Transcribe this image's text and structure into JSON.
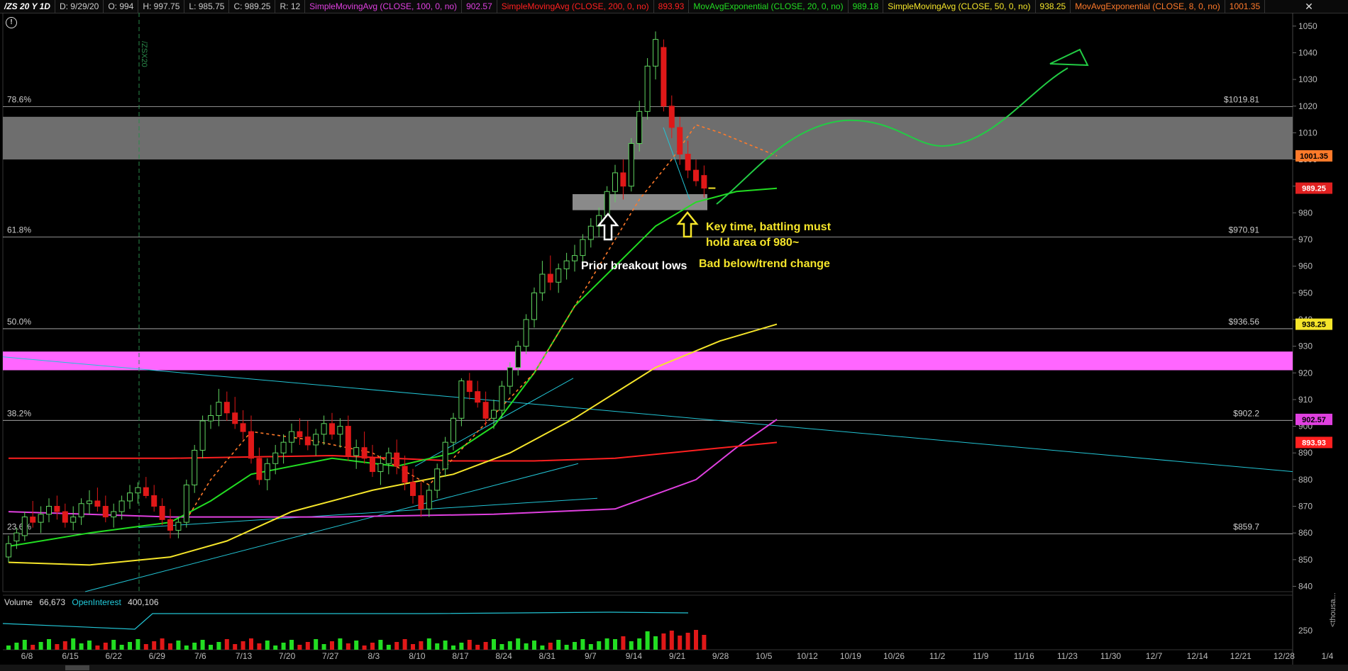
{
  "header": {
    "symbol": "/ZS 20 Y 1D",
    "date": "D: 9/29/20",
    "open": "O: 994",
    "high": "H: 997.75",
    "low": "L: 985.75",
    "close": "C: 989.25",
    "range": "R: 12",
    "studies": [
      {
        "label": "SimpleMovingAvg (CLOSE, 100, 0, no)",
        "value": "902.57",
        "color": "#e040e0"
      },
      {
        "label": "SimpleMovingAvg (CLOSE, 200, 0, no)",
        "value": "893.93",
        "color": "#ff2020"
      },
      {
        "label": "MovAvgExponential (CLOSE, 20, 0, no)",
        "value": "989.18",
        "color": "#22dd22"
      },
      {
        "label": "SimpleMovingAvg (CLOSE, 50, 0, no)",
        "value": "938.25",
        "color": "#f5e52a"
      },
      {
        "label": "MovAvgExponential (CLOSE, 8, 0, no)",
        "value": "1001.35",
        "color": "#ff7a2a"
      }
    ]
  },
  "chart_data": {
    "type": "candlestick",
    "ylim": [
      838,
      1055
    ],
    "y_ticks": [
      840,
      850,
      860,
      870,
      880,
      890,
      900,
      910,
      920,
      930,
      940,
      950,
      960,
      970,
      980,
      990,
      1000,
      1010,
      1020,
      1030,
      1040,
      1050
    ],
    "x_labels": [
      "6/8",
      "6/15",
      "6/22",
      "6/29",
      "7/6",
      "7/13",
      "7/20",
      "7/27",
      "8/3",
      "8/10",
      "8/17",
      "8/24",
      "8/31",
      "9/7",
      "9/14",
      "9/21",
      "9/28",
      "10/5",
      "10/12",
      "10/19",
      "10/26",
      "11/2",
      "11/9",
      "11/16",
      "11/23",
      "11/30",
      "12/7",
      "12/14",
      "12/21",
      "12/28",
      "1/4"
    ],
    "candles": [
      [
        851,
        859,
        849,
        856
      ],
      [
        857,
        862,
        854,
        860
      ],
      [
        859,
        868,
        857,
        866
      ],
      [
        866,
        872,
        862,
        864
      ],
      [
        864,
        870,
        860,
        867
      ],
      [
        867,
        873,
        864,
        870
      ],
      [
        870,
        874,
        865,
        868
      ],
      [
        868,
        871,
        862,
        864
      ],
      [
        864,
        870,
        861,
        866
      ],
      [
        866,
        873,
        863,
        871
      ],
      [
        871,
        876,
        867,
        872
      ],
      [
        872,
        877,
        868,
        870
      ],
      [
        870,
        874,
        864,
        866
      ],
      [
        866,
        871,
        862,
        868
      ],
      [
        868,
        874,
        865,
        872
      ],
      [
        872,
        878,
        869,
        875
      ],
      [
        875,
        879,
        871,
        877
      ],
      [
        877,
        881,
        873,
        874
      ],
      [
        874,
        878,
        868,
        870
      ],
      [
        870,
        873,
        863,
        865
      ],
      [
        865,
        869,
        858,
        861
      ],
      [
        861,
        866,
        858,
        864
      ],
      [
        864,
        880,
        862,
        878
      ],
      [
        878,
        893,
        875,
        891
      ],
      [
        891,
        904,
        888,
        902
      ],
      [
        902,
        908,
        899,
        904
      ],
      [
        904,
        914,
        900,
        909
      ],
      [
        909,
        913,
        902,
        905
      ],
      [
        905,
        911,
        899,
        901
      ],
      [
        901,
        906,
        895,
        898
      ],
      [
        898,
        904,
        886,
        888
      ],
      [
        888,
        892,
        878,
        880
      ],
      [
        880,
        888,
        876,
        886
      ],
      [
        886,
        893,
        882,
        890
      ],
      [
        890,
        897,
        886,
        894
      ],
      [
        894,
        901,
        890,
        898
      ],
      [
        898,
        903,
        893,
        896
      ],
      [
        896,
        902,
        891,
        893
      ],
      [
        893,
        899,
        889,
        897
      ],
      [
        897,
        904,
        893,
        901
      ],
      [
        901,
        905,
        895,
        897
      ],
      [
        897,
        903,
        892,
        900
      ],
      [
        900,
        904,
        887,
        889
      ],
      [
        889,
        895,
        884,
        892
      ],
      [
        892,
        898,
        886,
        888
      ],
      [
        888,
        893,
        881,
        883
      ],
      [
        883,
        889,
        878,
        886
      ],
      [
        886,
        892,
        882,
        890
      ],
      [
        890,
        895,
        882,
        885
      ],
      [
        885,
        889,
        876,
        879
      ],
      [
        879,
        884,
        871,
        874
      ],
      [
        874,
        879,
        866,
        869
      ],
      [
        869,
        878,
        866,
        876
      ],
      [
        876,
        886,
        873,
        884
      ],
      [
        884,
        896,
        881,
        894
      ],
      [
        894,
        905,
        891,
        903
      ],
      [
        903,
        918,
        900,
        917
      ],
      [
        917,
        920,
        910,
        913
      ],
      [
        913,
        917,
        907,
        909
      ],
      [
        909,
        913,
        900,
        903
      ],
      [
        903,
        910,
        899,
        906
      ],
      [
        906,
        917,
        903,
        915
      ],
      [
        915,
        924,
        912,
        922
      ],
      [
        922,
        932,
        919,
        930
      ],
      [
        930,
        942,
        927,
        940
      ],
      [
        940,
        952,
        937,
        950
      ],
      [
        950,
        962,
        947,
        957
      ],
      [
        957,
        964,
        951,
        954
      ],
      [
        954,
        961,
        950,
        959
      ],
      [
        959,
        965,
        955,
        962
      ],
      [
        962,
        968,
        958,
        964
      ],
      [
        964,
        972,
        961,
        970
      ],
      [
        970,
        978,
        967,
        975
      ],
      [
        975,
        982,
        971,
        979
      ],
      [
        979,
        990,
        977,
        988
      ],
      [
        988,
        998,
        984,
        995
      ],
      [
        995,
        1000,
        985,
        990
      ],
      [
        990,
        1008,
        988,
        1006
      ],
      [
        1006,
        1022,
        1003,
        1018
      ],
      [
        1018,
        1038,
        1015,
        1035
      ],
      [
        1035,
        1048,
        1030,
        1045
      ],
      [
        1042,
        1045,
        1018,
        1020
      ],
      [
        1020,
        1024,
        1008,
        1012
      ],
      [
        1012,
        1016,
        998,
        1002
      ],
      [
        1002,
        1007,
        993,
        996
      ],
      [
        996,
        1000,
        990,
        992
      ],
      [
        994,
        997.75,
        985.75,
        989.25
      ]
    ],
    "series": [
      {
        "name": "SimpleMovingAvg (CLOSE, 100, 0, no)",
        "color": "#e040e0",
        "points": [
          [
            0,
            868
          ],
          [
            20,
            866
          ],
          [
            40,
            866
          ],
          [
            60,
            867
          ],
          [
            75,
            869
          ],
          [
            85,
            880
          ],
          [
            90,
            892
          ],
          [
            95,
            902.57
          ]
        ]
      },
      {
        "name": "SimpleMovingAvg (CLOSE, 200, 0, no)",
        "color": "#ff2020",
        "points": [
          [
            0,
            888
          ],
          [
            20,
            888
          ],
          [
            40,
            889
          ],
          [
            55,
            887
          ],
          [
            65,
            887
          ],
          [
            75,
            888
          ],
          [
            85,
            891
          ],
          [
            95,
            893.93
          ]
        ]
      },
      {
        "name": "MovAvgExponential (CLOSE, 20, 0, no)",
        "color": "#22dd22",
        "points": [
          [
            0,
            855
          ],
          [
            10,
            860
          ],
          [
            20,
            864
          ],
          [
            25,
            872
          ],
          [
            30,
            882
          ],
          [
            40,
            888
          ],
          [
            48,
            885
          ],
          [
            55,
            890
          ],
          [
            60,
            900
          ],
          [
            65,
            920
          ],
          [
            70,
            945
          ],
          [
            75,
            960
          ],
          [
            80,
            975
          ],
          [
            85,
            984
          ],
          [
            90,
            988
          ],
          [
            95,
            989.18
          ]
        ]
      },
      {
        "name": "SimpleMovingAvg (CLOSE, 50, 0, no)",
        "color": "#f5e52a",
        "points": [
          [
            0,
            849
          ],
          [
            10,
            848
          ],
          [
            20,
            851
          ],
          [
            27,
            857
          ],
          [
            35,
            868
          ],
          [
            45,
            876
          ],
          [
            55,
            882
          ],
          [
            62,
            890
          ],
          [
            70,
            903
          ],
          [
            80,
            922
          ],
          [
            88,
            932
          ],
          [
            95,
            938.25
          ]
        ]
      },
      {
        "name": "MovAvgExponential (CLOSE, 8, 0, no)",
        "color": "#ff7a2a",
        "points": [
          [
            22,
            865
          ],
          [
            25,
            880
          ],
          [
            30,
            898
          ],
          [
            37,
            895
          ],
          [
            45,
            890
          ],
          [
            52,
            878
          ],
          [
            58,
            898
          ],
          [
            65,
            920
          ],
          [
            72,
            955
          ],
          [
            78,
            985
          ],
          [
            82,
            1000
          ],
          [
            85,
            1013
          ],
          [
            88,
            1010
          ],
          [
            95,
            1001.35
          ]
        ]
      }
    ],
    "fib_levels": [
      {
        "label": "78.6%",
        "price_label": "$1019.81",
        "value": 1019.81
      },
      {
        "label": "61.8%",
        "price_label": "$970.91",
        "value": 970.91
      },
      {
        "label": "50.0%",
        "price_label": "$936.56",
        "value": 936.56
      },
      {
        "label": "38.2%",
        "price_label": "$902.2",
        "value": 902.2
      },
      {
        "label": "23.6%",
        "price_label": "$859.7",
        "value": 859.7
      }
    ],
    "zones": [
      {
        "from": 1000,
        "to": 1016,
        "color": "#6e6e6e",
        "x0": 0,
        "x1": 1
      },
      {
        "from": 921,
        "to": 928,
        "color": "#ff66ff",
        "x0": 0,
        "x1": 1
      },
      {
        "from": 981,
        "to": 987,
        "color": "#8a8a8a",
        "x0": 0.44,
        "x1": 0.545
      }
    ],
    "right_price_tags": [
      {
        "value": 1001.35,
        "text": "1001.35",
        "bg": "#ff7a2a",
        "fg": "#000"
      },
      {
        "value": 989.25,
        "text": "989.25",
        "bg": "#e02020",
        "fg": "#fff"
      },
      {
        "value": 938.25,
        "text": "938.25",
        "bg": "#f5e52a",
        "fg": "#000"
      },
      {
        "value": 902.57,
        "text": "902.57",
        "bg": "#e040e0",
        "fg": "#000"
      },
      {
        "value": 893.93,
        "text": "893.93",
        "bg": "#ff2020",
        "fg": "#fff"
      }
    ],
    "vertical_marker_label": "/ZSX20",
    "volume": {
      "label": "Volume",
      "value": "66,673",
      "oi_label": "OpenInterest",
      "oi_value": "400,106",
      "tick": "250",
      "unit_label": "<thousa..."
    }
  },
  "annotations": {
    "prior_breakout": "Prior breakout lows",
    "key_time_1": "Key time, battling must",
    "key_time_2": "hold area of 980~",
    "bad_below": "Bad below/trend change"
  }
}
